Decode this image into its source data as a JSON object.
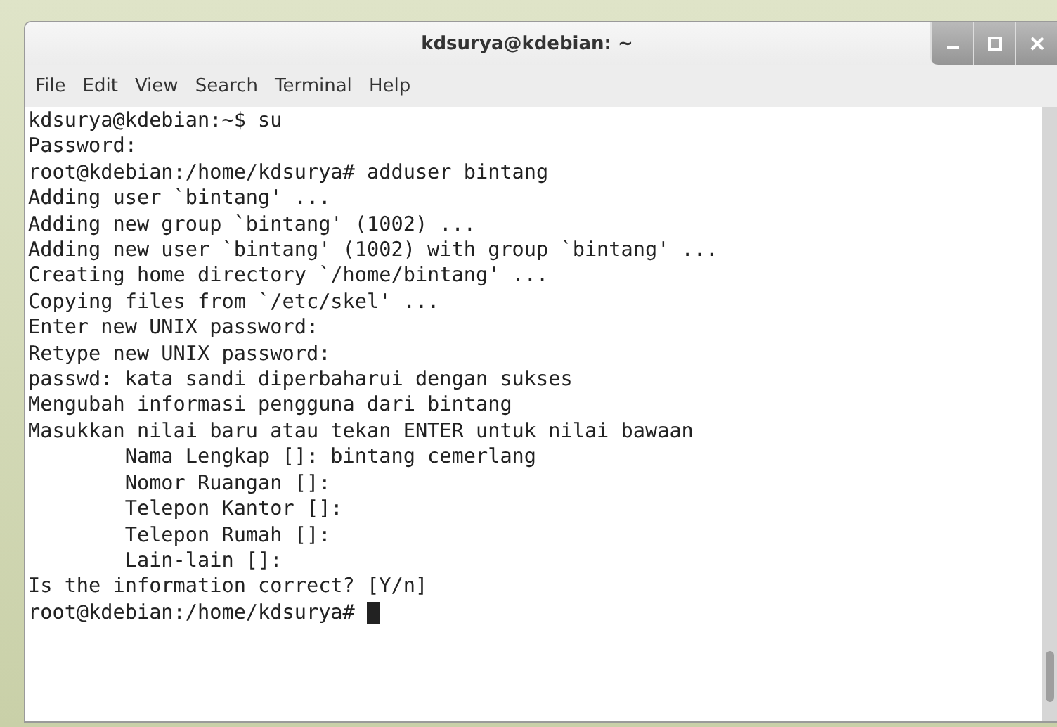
{
  "window": {
    "title": "kdsurya@kdebian: ~"
  },
  "menu": [
    "File",
    "Edit",
    "View",
    "Search",
    "Terminal",
    "Help"
  ],
  "terminal": {
    "lines": [
      "kdsurya@kdebian:~$ su",
      "Password:",
      "root@kdebian:/home/kdsurya# adduser bintang",
      "Adding user `bintang' ...",
      "Adding new group `bintang' (1002) ...",
      "Adding new user `bintang' (1002) with group `bintang' ...",
      "Creating home directory `/home/bintang' ...",
      "Copying files from `/etc/skel' ...",
      "Enter new UNIX password:",
      "Retype new UNIX password:",
      "passwd: kata sandi diperbaharui dengan sukses",
      "Mengubah informasi pengguna dari bintang",
      "Masukkan nilai baru atau tekan ENTER untuk nilai bawaan",
      "        Nama Lengkap []: bintang cemerlang",
      "        Nomor Ruangan []:",
      "        Telepon Kantor []:",
      "        Telepon Rumah []:",
      "        Lain-lain []:",
      "Is the information correct? [Y/n]"
    ],
    "prompt": "root@kdebian:/home/kdsurya#"
  }
}
